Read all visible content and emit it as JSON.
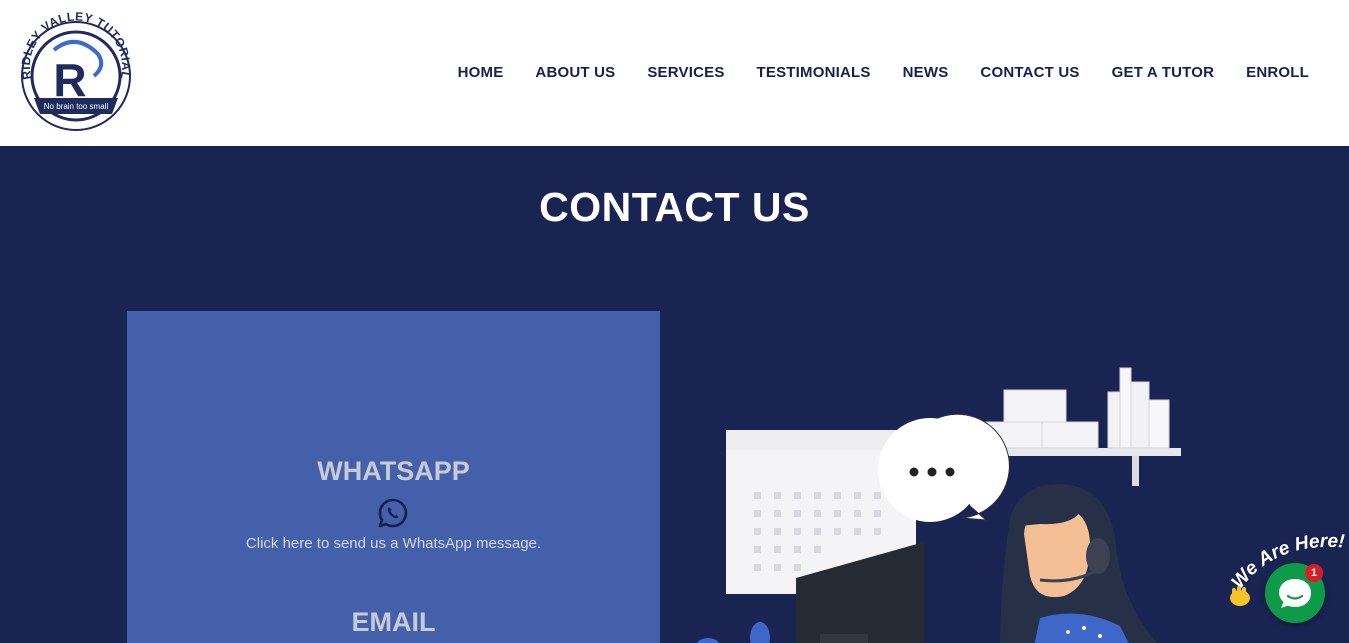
{
  "header": {
    "logo": {
      "text_ring": "RIDLEY VALLEY TUTORIAL",
      "monogram": "R",
      "tagline": "No brain too small"
    },
    "nav": [
      {
        "label": "HOME"
      },
      {
        "label": "ABOUT US"
      },
      {
        "label": "SERVICES"
      },
      {
        "label": "TESTIMONIALS"
      },
      {
        "label": "NEWS"
      },
      {
        "label": "CONTACT US"
      },
      {
        "label": "GET A TUTOR"
      },
      {
        "label": "ENROLL"
      }
    ]
  },
  "main": {
    "title": "CONTACT US",
    "whatsapp": {
      "heading": "WHATSAPP",
      "icon": "whatsapp-icon",
      "text": "Click here to send us a WhatsApp message."
    },
    "email": {
      "heading": "EMAIL"
    },
    "illustration": "support-agent-illustration"
  },
  "chat_widget": {
    "label": "We Are Here!",
    "badge_count": "1",
    "icon": "chat-bubble-icon"
  },
  "colors": {
    "nav_text": "#16224d",
    "main_bg": "#192453",
    "card_bg": "#4460aa",
    "chat_green": "#0d9a49",
    "badge_red": "#d71e28"
  }
}
